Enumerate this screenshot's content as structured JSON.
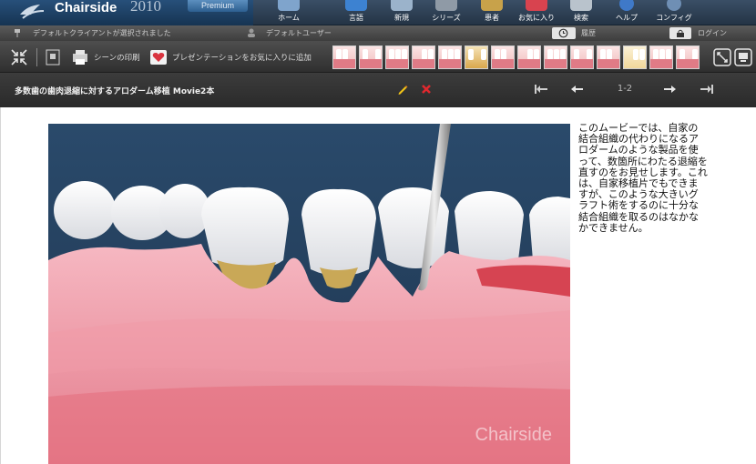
{
  "app": {
    "name": "Chairside",
    "year": "2010",
    "edition": "Premium"
  },
  "nav": [
    {
      "label": "ホーム",
      "icon": "home-icon"
    },
    {
      "label": "言語",
      "icon": "language-icon"
    },
    {
      "label": "新規",
      "icon": "new-icon"
    },
    {
      "label": "シリーズ",
      "icon": "series-icon"
    },
    {
      "label": "患者",
      "icon": "patient-icon"
    },
    {
      "label": "お気に入り",
      "icon": "favorites-icon"
    },
    {
      "label": "検索",
      "icon": "search-icon"
    },
    {
      "label": "ヘルプ",
      "icon": "help-icon"
    },
    {
      "label": "コンフィグ",
      "icon": "config-icon"
    }
  ],
  "status": {
    "client": "デフォルトクライアントが選択されました",
    "user": "デフォルトユーザー",
    "history": "履歴",
    "login": "ログイン"
  },
  "toolbar": {
    "print_label": "シーンの印刷",
    "favorite_label": "プレゼンテーションをお気に入りに追加"
  },
  "movie": {
    "title": "多数歯の歯肉退縮に対するアロダーム移植 Movie2本",
    "page": "1-2",
    "watermark": "Chairside",
    "description": "このムービーでは、自家の結合組織の代わりになるアロダームのような製品を使って、数箇所にわたる退縮を直すのをお見せします。これは、自家移植片でもできますが、このような大きいグラフト術をするのに十分な結合組織を取るのはなかなかできません。"
  },
  "colors": {
    "header": "#2c3e52",
    "toolbar": "#3e3e3e",
    "video_bg": "#233f5c",
    "gum": "#ef9aa6",
    "accent_red": "#e0282e",
    "edit_yellow": "#f2c417"
  }
}
